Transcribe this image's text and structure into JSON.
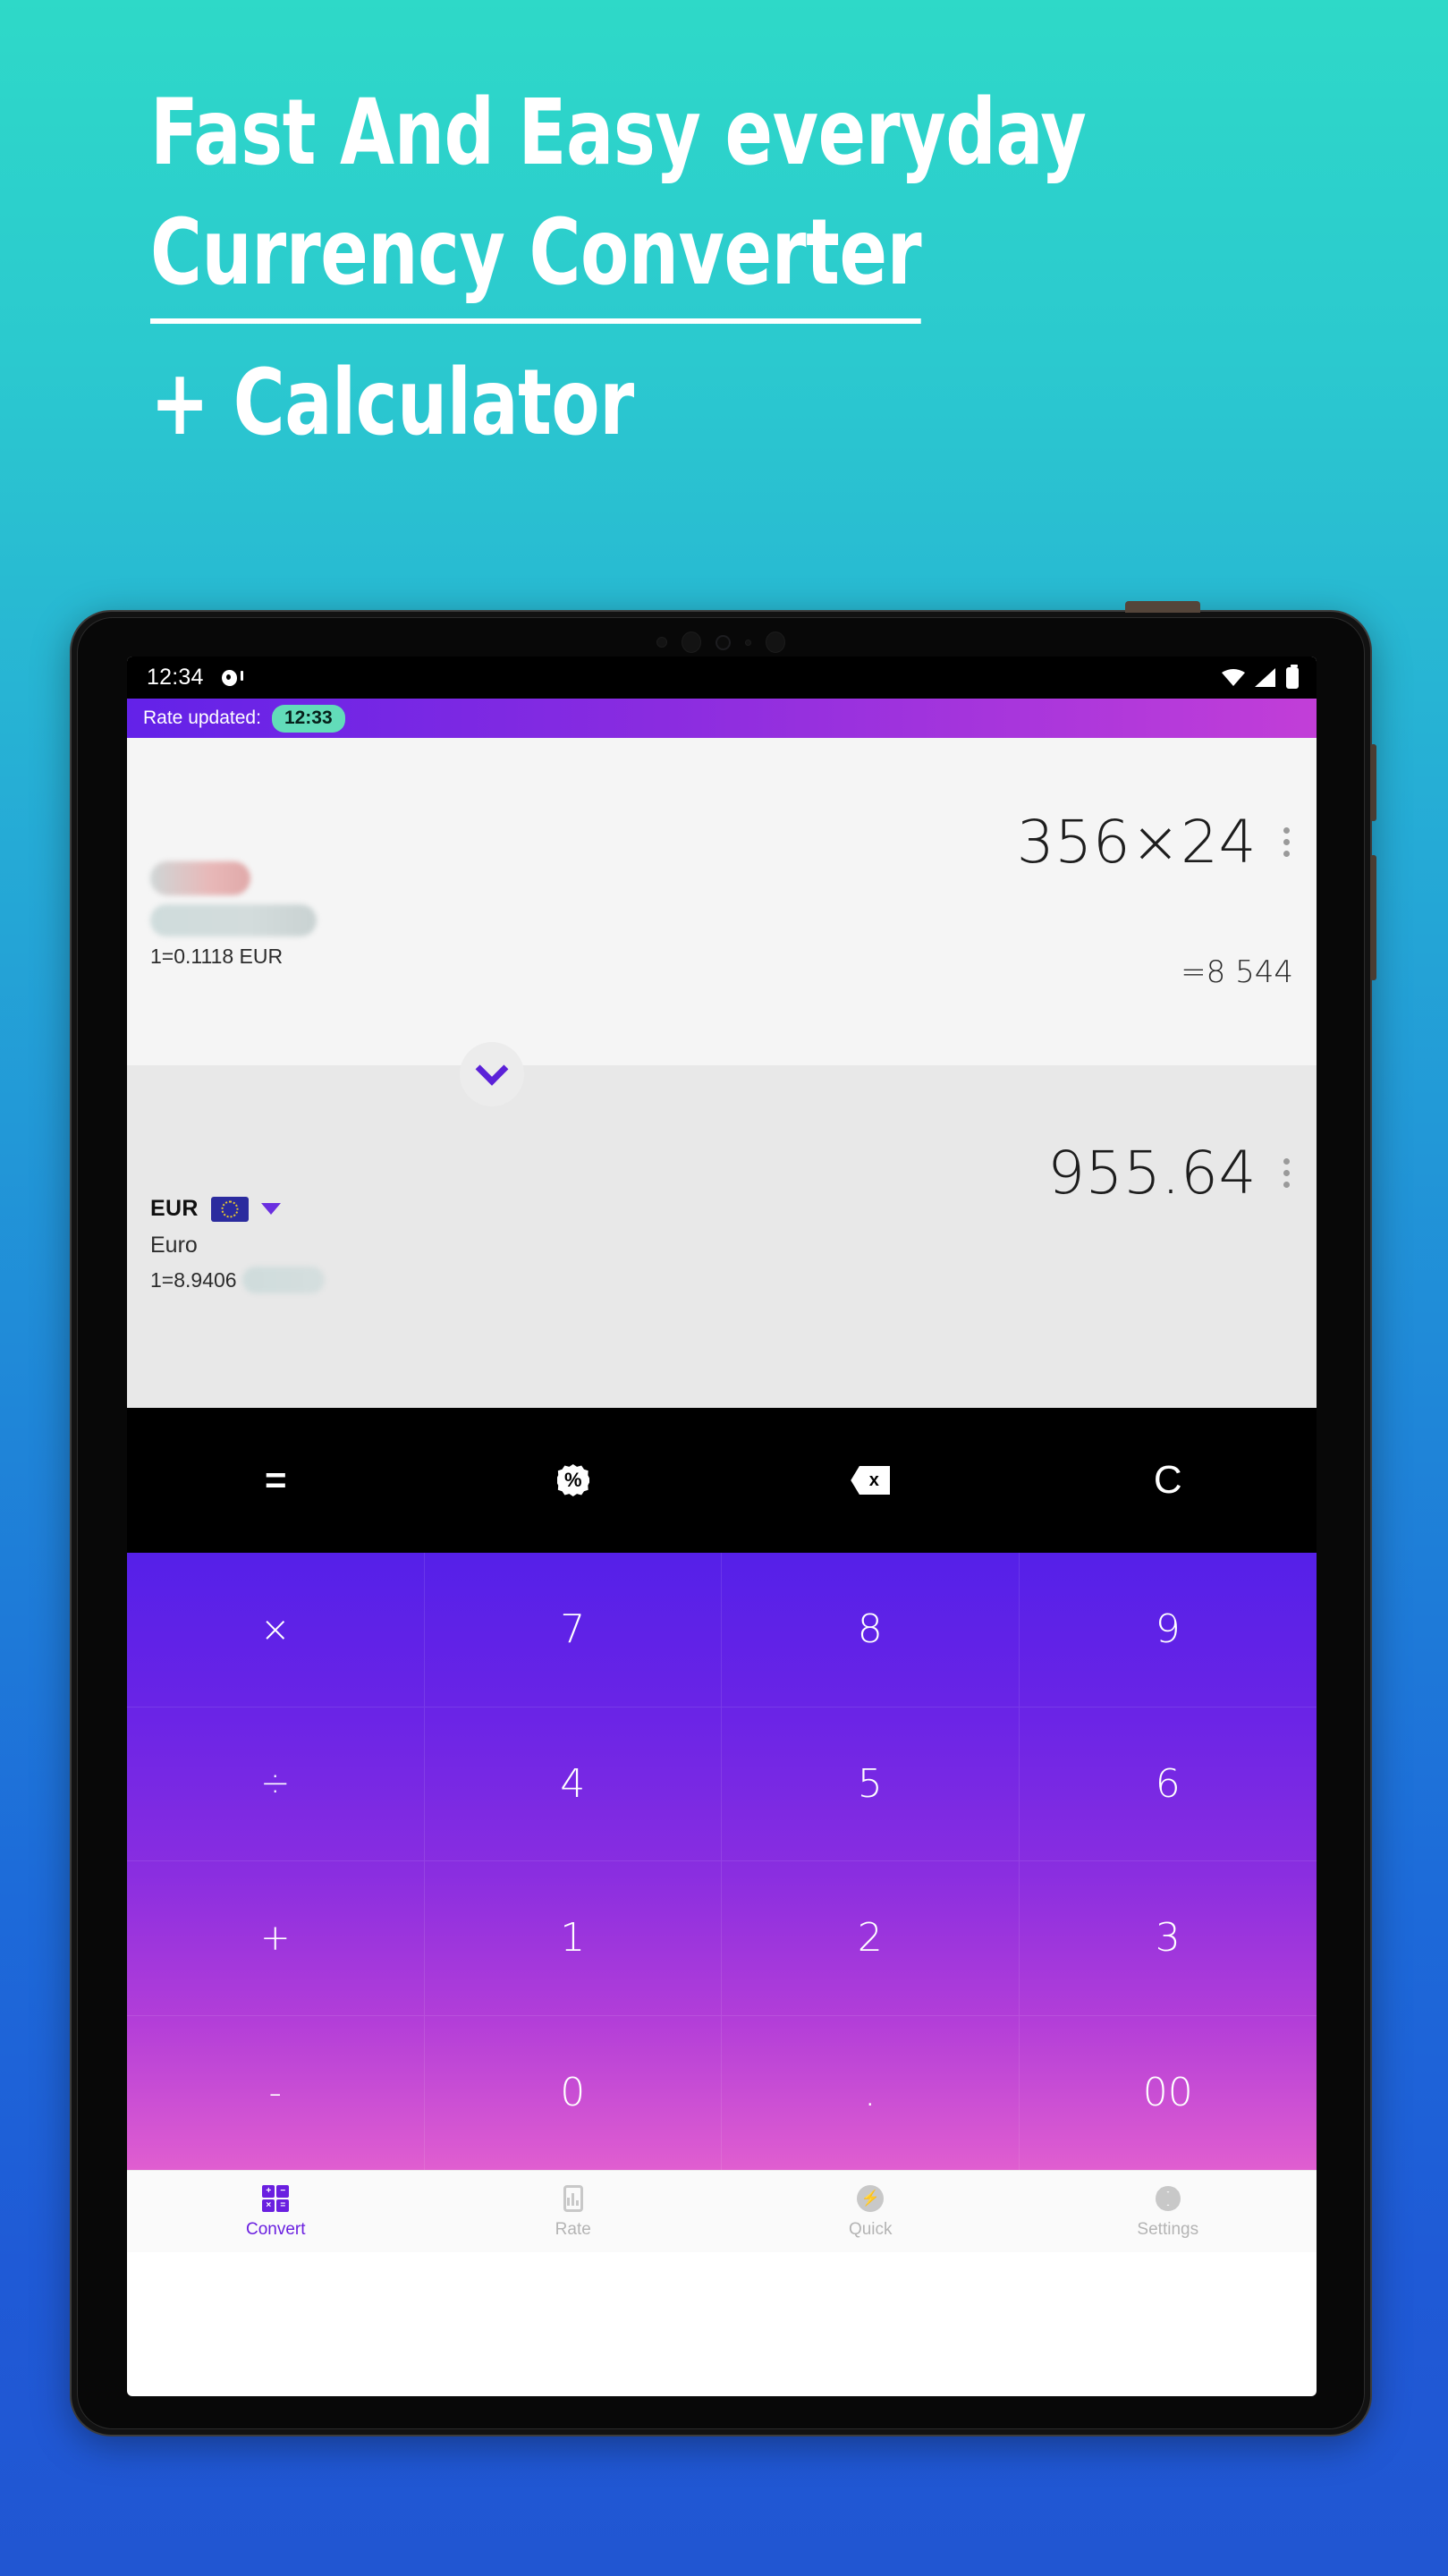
{
  "promo": {
    "line1": "Fast And Easy everyday",
    "line2": "Currency Converter",
    "line3": "+ Calculator",
    "bg_top_color": "#2ed9c8",
    "bg_bottom_color": "#2156d2"
  },
  "statusbar": {
    "clock": "12:34",
    "notification_icon": "notification-blob-icon",
    "wifi_icon": "wifi-icon",
    "signal_icon": "cell-signal-icon",
    "battery_icon": "battery-icon"
  },
  "ratebar": {
    "label": "Rate updated:",
    "time": "12:33",
    "pill_color": "#62dcb9",
    "gradient_from": "#6322e8",
    "gradient_to": "#c23ed8"
  },
  "converter": {
    "source": {
      "expression": "356×24",
      "result": "=8 544",
      "code_redacted": true,
      "name_redacted": true,
      "rate_line": "1=0.1118 EUR",
      "menu_icon": "kebab-menu-icon"
    },
    "swap_icon": "chevron-down-icon",
    "target": {
      "amount": "955.64",
      "code": "EUR",
      "flag_icon": "eu-flag-icon",
      "dropdown_icon": "caret-down-icon",
      "name": "Euro",
      "rate_prefix": "1=8.9406",
      "rate_suffix_redacted": true,
      "menu_icon": "kebab-menu-icon"
    }
  },
  "functions": [
    {
      "label": "=",
      "name": "equals-button",
      "kind": "text"
    },
    {
      "label": "%",
      "name": "percent-button",
      "kind": "badge"
    },
    {
      "label": "x",
      "name": "backspace-button",
      "kind": "backspace"
    },
    {
      "label": "C",
      "name": "clear-button",
      "kind": "text"
    }
  ],
  "keypad": {
    "keys": [
      {
        "label": "×",
        "name": "key-multiply",
        "op": true
      },
      {
        "label": "7",
        "name": "key-7",
        "op": false
      },
      {
        "label": "8",
        "name": "key-8",
        "op": false
      },
      {
        "label": "9",
        "name": "key-9",
        "op": false
      },
      {
        "label": "÷",
        "name": "key-divide",
        "op": true
      },
      {
        "label": "4",
        "name": "key-4",
        "op": false
      },
      {
        "label": "5",
        "name": "key-5",
        "op": false
      },
      {
        "label": "6",
        "name": "key-6",
        "op": false
      },
      {
        "label": "+",
        "name": "key-plus",
        "op": true
      },
      {
        "label": "1",
        "name": "key-1",
        "op": false
      },
      {
        "label": "2",
        "name": "key-2",
        "op": false
      },
      {
        "label": "3",
        "name": "key-3",
        "op": false
      },
      {
        "label": "-",
        "name": "key-minus",
        "op": true
      },
      {
        "label": "0",
        "name": "key-0",
        "op": false
      },
      {
        "label": ".",
        "name": "key-decimal",
        "op": false
      },
      {
        "label": "00",
        "name": "key-double-zero",
        "op": false
      }
    ],
    "gradient_from": "#5520e8",
    "gradient_to": "#e05ed0"
  },
  "bottomnav": {
    "items": [
      {
        "label": "Convert",
        "icon": "convert-grid-icon",
        "active": true
      },
      {
        "label": "Rate",
        "icon": "rate-chart-icon",
        "active": false
      },
      {
        "label": "Quick",
        "icon": "quick-bolt-icon",
        "active": false
      },
      {
        "label": "Settings",
        "icon": "gear-icon",
        "active": false
      }
    ],
    "active_color": "#6a1fe0",
    "inactive_color": "#b4b4b4"
  }
}
